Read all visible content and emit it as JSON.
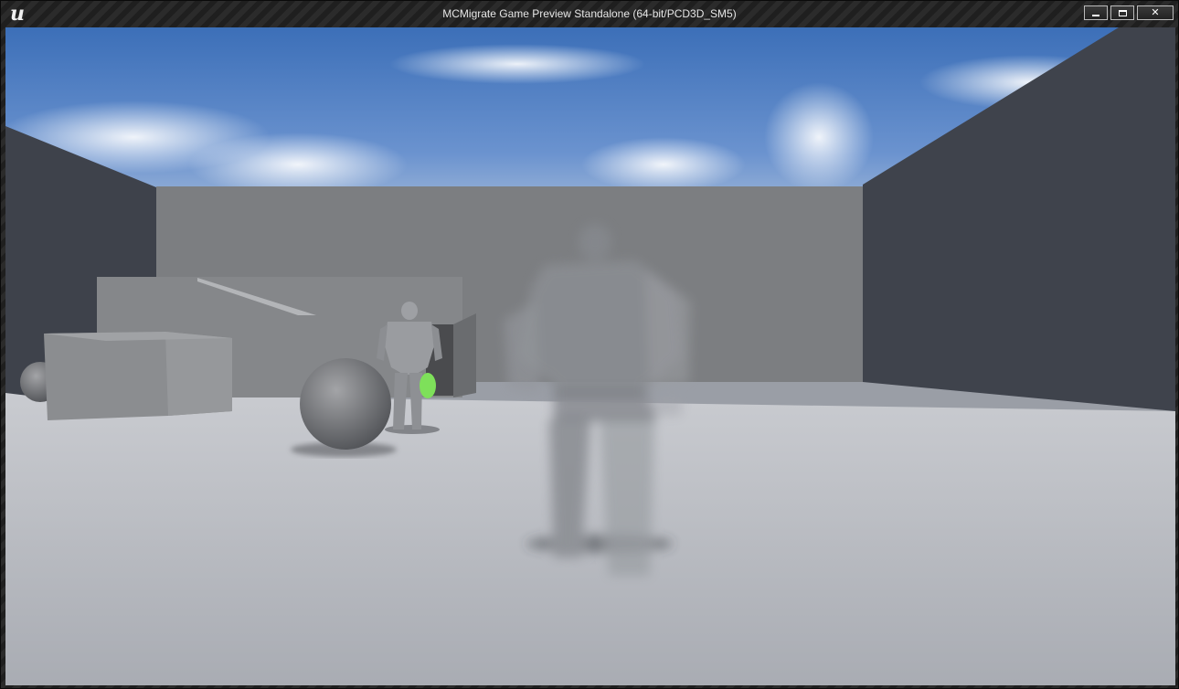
{
  "window": {
    "title": "MCMigrate Game Preview Standalone (64-bit/PCD3D_SM5)",
    "logo_icon": "unreal-engine-logo-icon",
    "logo_glyph": "u"
  },
  "controls": {
    "minimize_icon": "minimize-icon",
    "maximize_icon": "maximize-icon",
    "close_icon": "close-icon",
    "close_glyph": "✕"
  },
  "scene": {
    "sky_color": "#4f7fc4",
    "floor_color": "#b9bcc2",
    "wall_color": "#7b7d80",
    "side_wall_color": "#3f434c",
    "highlight_color": "#7ee05a"
  }
}
